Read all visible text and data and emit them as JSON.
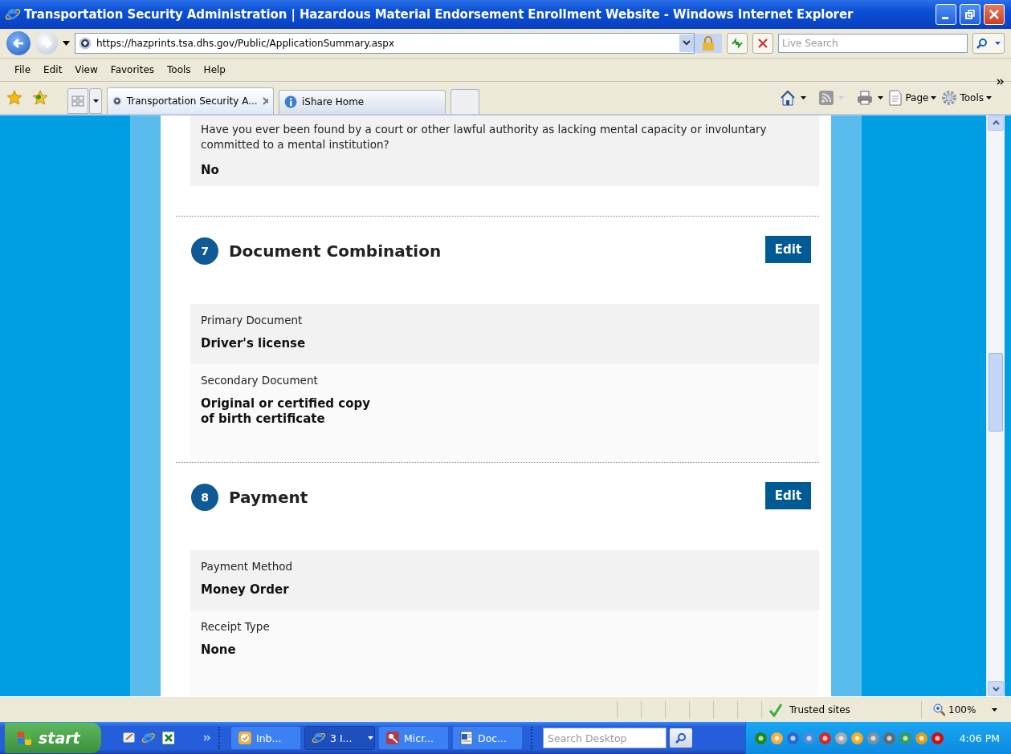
{
  "window": {
    "title": "Transportation Security Administration | Hazardous Material Endorsement Enrollment Website - Windows Internet Explorer"
  },
  "address_bar": {
    "url": "https://hazprints.tsa.dhs.gov/Public/ApplicationSummary.aspx",
    "search_placeholder": "Live Search"
  },
  "menu": [
    "File",
    "Edit",
    "View",
    "Favorites",
    "Tools",
    "Help"
  ],
  "tabs": [
    {
      "label": "Transportation Security A...",
      "selected": true
    },
    {
      "label": "iShare Home",
      "selected": false
    }
  ],
  "command_bar": [
    "Page",
    "Tools"
  ],
  "content": {
    "question": {
      "text": "Have you ever been found by a court or other lawful authority as lacking mental capacity or involuntary committed to a mental institution?",
      "answer": "No"
    },
    "sections": [
      {
        "number": "7",
        "title": "Document Combination",
        "edit": "Edit",
        "fields": [
          {
            "label": "Primary Document",
            "value": "Driver's license"
          },
          {
            "label": "Secondary Document",
            "value": "Original or certified copy\nof birth certificate"
          }
        ]
      },
      {
        "number": "8",
        "title": "Payment",
        "edit": "Edit",
        "fields": [
          {
            "label": "Payment Method",
            "value": "Money Order"
          },
          {
            "label": "Receipt Type",
            "value": "None"
          }
        ]
      }
    ]
  },
  "status_bar": {
    "zone": "Trusted sites",
    "zoom": "100%"
  },
  "taskbar": {
    "start": "start",
    "buttons": [
      {
        "label": "Inb...",
        "kind": "mail",
        "selected": false
      },
      {
        "label": "3 I...",
        "kind": "browser",
        "selected": true
      },
      {
        "label": "Micr...",
        "kind": "key",
        "selected": false
      },
      {
        "label": "Doc...",
        "kind": "doc",
        "selected": false
      }
    ],
    "search_placeholder": "Search Desktop",
    "clock": "4:06 PM"
  }
}
